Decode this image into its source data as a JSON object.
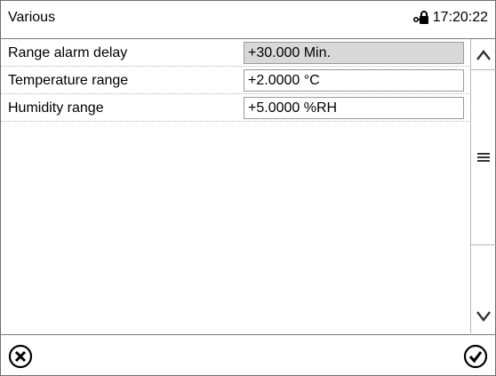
{
  "header": {
    "title": "Various",
    "time": "17:20:22",
    "status_icon": "lock-icon"
  },
  "rows": [
    {
      "label": "Range alarm delay",
      "value": "+30.000 Min.",
      "state": "disabled"
    },
    {
      "label": "Temperature range",
      "value": "+2.0000 °C",
      "state": "editable"
    },
    {
      "label": "Humidity range",
      "value": "+5.0000 %RH",
      "state": "editable"
    }
  ],
  "scrollbar": {
    "up_icon": "chevron-up-icon",
    "thumb_icon": "menu-icon",
    "down_icon": "chevron-down-icon"
  },
  "footer": {
    "cancel_icon": "close-circle-icon",
    "confirm_icon": "check-circle-icon"
  }
}
